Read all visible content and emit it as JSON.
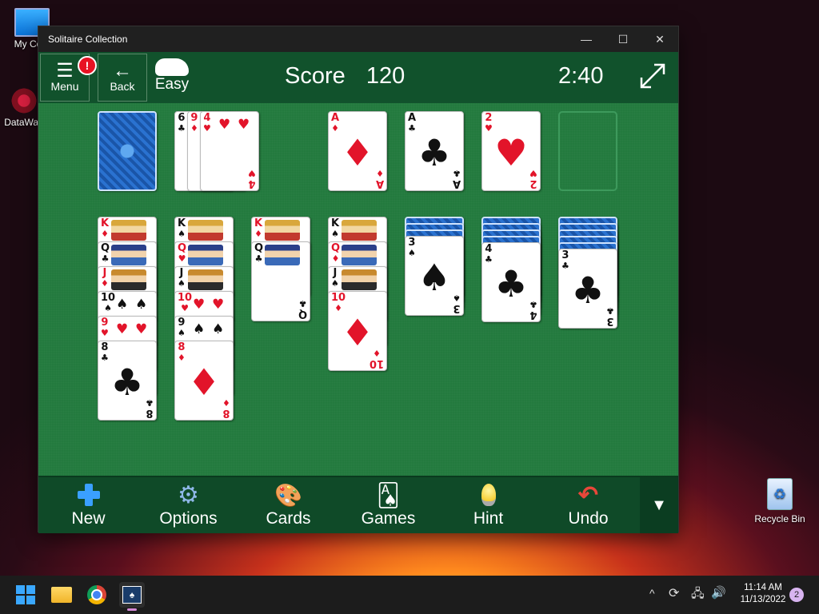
{
  "desktop": {
    "icons": [
      {
        "label": "My Com"
      },
      {
        "label": "DataWag"
      },
      {
        "label": "Recycle Bin"
      }
    ]
  },
  "window": {
    "title": "Solitaire Collection",
    "controls": {
      "minimize": "—",
      "maximize": "☐",
      "close": "✕"
    }
  },
  "topbar": {
    "menu_label": "Menu",
    "alert_badge": "!",
    "back_label": "Back",
    "difficulty_label": "Easy",
    "score_label": "Score",
    "score_value": "120",
    "timer": "2:40"
  },
  "stock": {
    "cards": "face-down"
  },
  "waste": {
    "cards": [
      {
        "rank": "6",
        "suit": "♣"
      },
      {
        "rank": "9",
        "suit": "♦"
      },
      {
        "rank": "4",
        "suit": "♥"
      }
    ]
  },
  "foundations": [
    {
      "rank": "A",
      "suit": "♦"
    },
    {
      "rank": "A",
      "suit": "♣"
    },
    {
      "rank": "2",
      "suit": "♥"
    },
    {
      "rank": "",
      "suit": ""
    }
  ],
  "tableau": [
    {
      "hidden": 0,
      "cards": [
        {
          "rank": "K",
          "suit": "♦"
        },
        {
          "rank": "Q",
          "suit": "♣"
        },
        {
          "rank": "J",
          "suit": "♦"
        },
        {
          "rank": "10",
          "suit": "♠"
        },
        {
          "rank": "9",
          "suit": "♥"
        },
        {
          "rank": "8",
          "suit": "♣"
        }
      ]
    },
    {
      "hidden": 0,
      "cards": [
        {
          "rank": "K",
          "suit": "♠"
        },
        {
          "rank": "Q",
          "suit": "♥"
        },
        {
          "rank": "J",
          "suit": "♠"
        },
        {
          "rank": "10",
          "suit": "♥"
        },
        {
          "rank": "9",
          "suit": "♠"
        },
        {
          "rank": "8",
          "suit": "♦"
        }
      ]
    },
    {
      "hidden": 0,
      "cards": [
        {
          "rank": "K",
          "suit": "♦"
        },
        {
          "rank": "Q",
          "suit": "♣"
        }
      ]
    },
    {
      "hidden": 0,
      "cards": [
        {
          "rank": "K",
          "suit": "♠"
        },
        {
          "rank": "Q",
          "suit": "♦"
        },
        {
          "rank": "J",
          "suit": "♠"
        },
        {
          "rank": "10",
          "suit": "♦"
        }
      ]
    },
    {
      "hidden": 3,
      "cards": [
        {
          "rank": "3",
          "suit": "♠"
        }
      ]
    },
    {
      "hidden": 4,
      "cards": [
        {
          "rank": "4",
          "suit": "♣"
        }
      ]
    },
    {
      "hidden": 5,
      "cards": [
        {
          "rank": "3",
          "suit": "♣"
        }
      ]
    }
  ],
  "bottombar": {
    "new_label": "New",
    "options_label": "Options",
    "cards_label": "Cards",
    "games_label": "Games",
    "hint_label": "Hint",
    "undo_label": "Undo"
  },
  "taskbar": {
    "time": "11:14 AM",
    "date": "11/13/2022",
    "notification_count": "2"
  },
  "colors": {
    "felt": "#237a3e",
    "topbar": "#11522c",
    "red_suit": "#e2142a",
    "card_back": "#1d5fb8"
  }
}
